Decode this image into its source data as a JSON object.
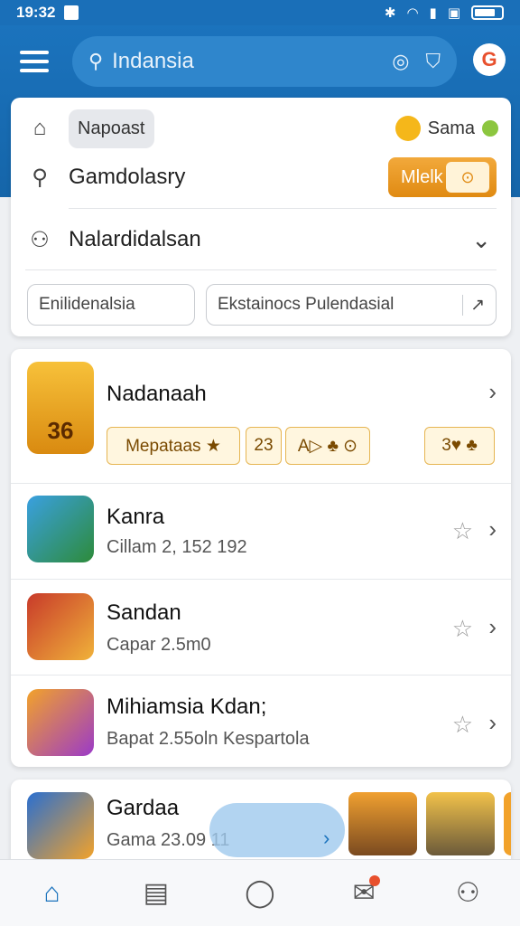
{
  "status_bar": {
    "time": "19:32",
    "icons": [
      "bluetooth-icon",
      "wifi-icon",
      "signal-icon",
      "nfc-icon",
      "battery-icon"
    ]
  },
  "header": {
    "search_value": "Indansia",
    "search_icon": "search-icon",
    "lens_icon": "camera-lens-icon",
    "shield_icon": "shield-icon",
    "brand_color": "#1b73bd"
  },
  "dropdown": {
    "item1": {
      "chip": "Napoast",
      "right_label": "Sama"
    },
    "item2": {
      "label": "Gamdolasry",
      "button_label": "Mlelk",
      "button_icon": "⊙"
    },
    "item3": {
      "label": "Nalardidalsan"
    },
    "pills": [
      "Enilidenalsia",
      "Ekstainocs Pulendasial"
    ]
  },
  "list": {
    "featured": {
      "title": "Nadanaah",
      "icon_text": "36",
      "tags": [
        "Mepataas ★",
        "23",
        "A▷ ♣ ⊙",
        "3♥ ♣"
      ]
    },
    "items": [
      {
        "title": "Kanra",
        "subtitle": "Cillam 2, 152 192"
      },
      {
        "title": "Sandan",
        "subtitle": "Capar 2.5m0"
      },
      {
        "title": "Mihiamsia Kdan;",
        "subtitle": "Bapat 2.55oln Kespartola"
      }
    ]
  },
  "bottom_card": {
    "title": "Gardaa",
    "subtitle": "Gama 23.09 11"
  },
  "nav": [
    "home-icon",
    "notes-icon",
    "info-icon",
    "inbox-icon",
    "profile-icon"
  ]
}
